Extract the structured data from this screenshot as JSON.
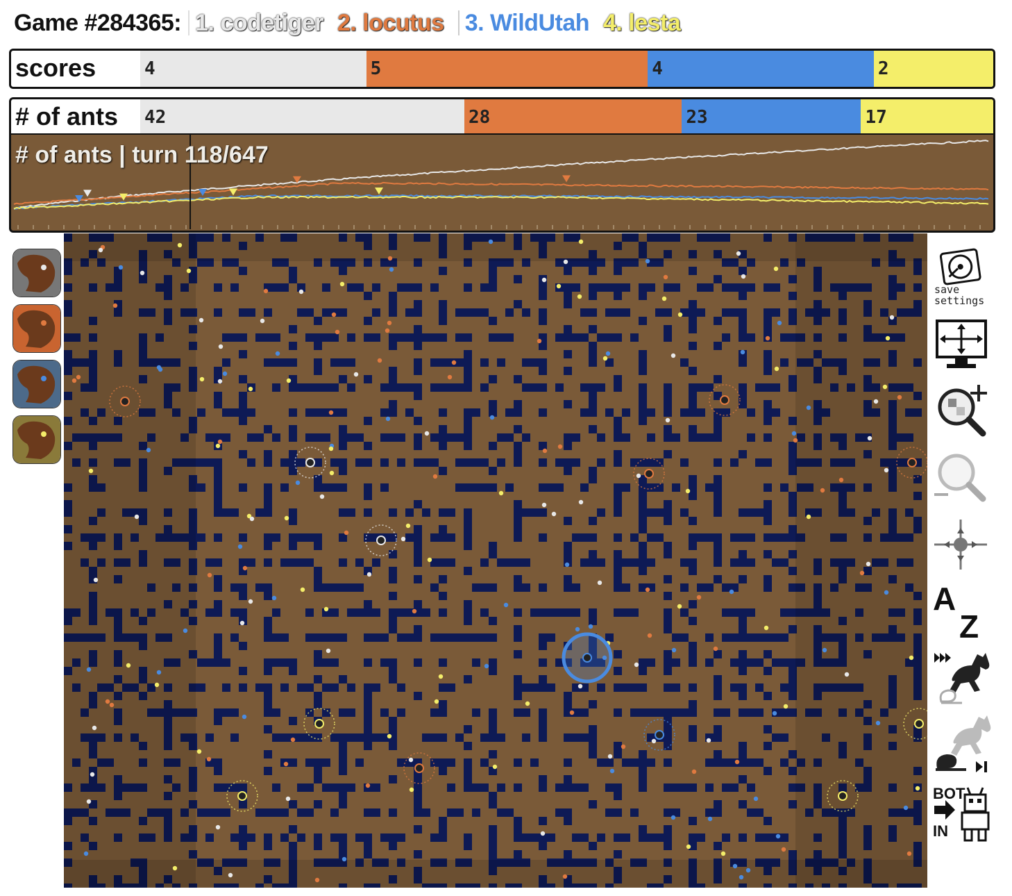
{
  "header": {
    "game_label": "Game #284365:",
    "players": [
      {
        "label": "1. codetiger",
        "color": "#e8e8e8"
      },
      {
        "label": "2. locutus",
        "color": "#e07a40"
      },
      {
        "label": "3. WildUtah",
        "color": "#4a8be0"
      },
      {
        "label": "4. lesta",
        "color": "#f4ee6a"
      }
    ]
  },
  "scores": {
    "label": "scores",
    "values": [
      "4",
      "5",
      "4",
      "2"
    ],
    "shares": [
      0.265,
      0.33,
      0.265,
      0.14
    ]
  },
  "ants": {
    "label": "# of ants",
    "values": [
      "42",
      "28",
      "23",
      "17"
    ],
    "shares": [
      0.38,
      0.255,
      0.21,
      0.155
    ]
  },
  "graph": {
    "title": "# of ants | turn 118/647",
    "turn": 118,
    "total_turns": 647
  },
  "colors": {
    "dirt": "#7a5a38",
    "water": "#0e1a55",
    "p1": "#e8e8e8",
    "p2": "#e07a40",
    "p3": "#4a8be0",
    "p4": "#f4ee6a"
  },
  "toolbar": {
    "save_label_1": "save",
    "save_label_2": "settings",
    "labels_a": "A",
    "labels_z": "Z",
    "bot_label": "BOT",
    "in_label": "IN"
  }
}
